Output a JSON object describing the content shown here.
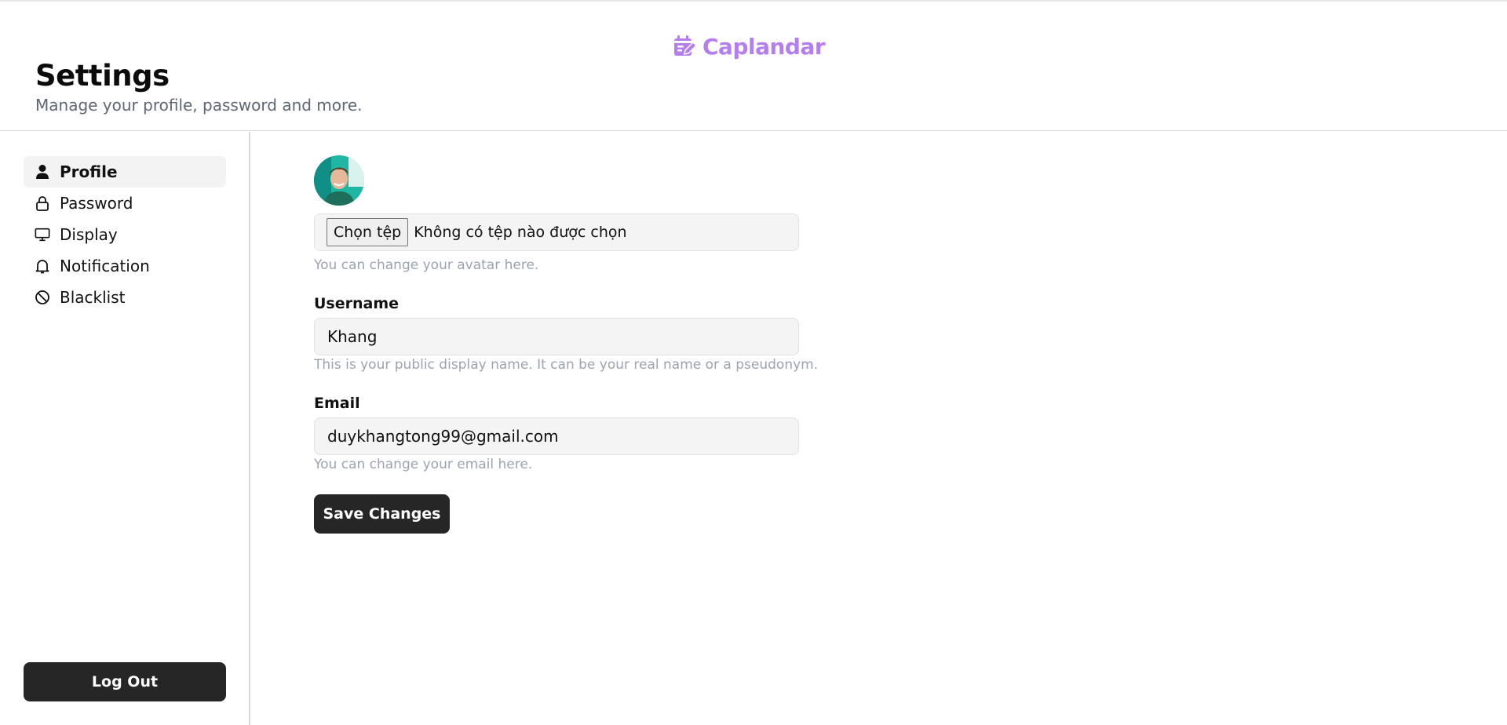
{
  "app": {
    "brand_name": "Caplandar",
    "brand_icon": "calendar-edit-icon",
    "brand_color": "#b57ef0"
  },
  "header": {
    "title": "Settings",
    "subtitle": "Manage your profile, password and more."
  },
  "sidebar": {
    "items": [
      {
        "label": "Profile",
        "icon": "user-icon",
        "active": true
      },
      {
        "label": "Password",
        "icon": "lock-icon",
        "active": false
      },
      {
        "label": "Display",
        "icon": "monitor-icon",
        "active": false
      },
      {
        "label": "Notification",
        "icon": "bell-icon",
        "active": false
      },
      {
        "label": "Blacklist",
        "icon": "ban-icon",
        "active": false
      }
    ],
    "logout_label": "Log Out"
  },
  "profile_form": {
    "avatar": {
      "upload_button": "Chọn tệp",
      "file_status": "Không có tệp nào được chọn",
      "hint": "You can change your avatar here."
    },
    "username": {
      "label": "Username",
      "value": "Khang",
      "hint": "This is your public display name. It can be your real name or a pseudonym."
    },
    "email": {
      "label": "Email",
      "value": "duykhangtong99@gmail.com",
      "hint": "You can change your email here."
    },
    "save_label": "Save Changes"
  },
  "colors": {
    "primary_button": "#262626",
    "active_nav_bg": "#f3f3f3",
    "hint_text": "#9ca3af",
    "subtitle_text": "#5f6673"
  }
}
